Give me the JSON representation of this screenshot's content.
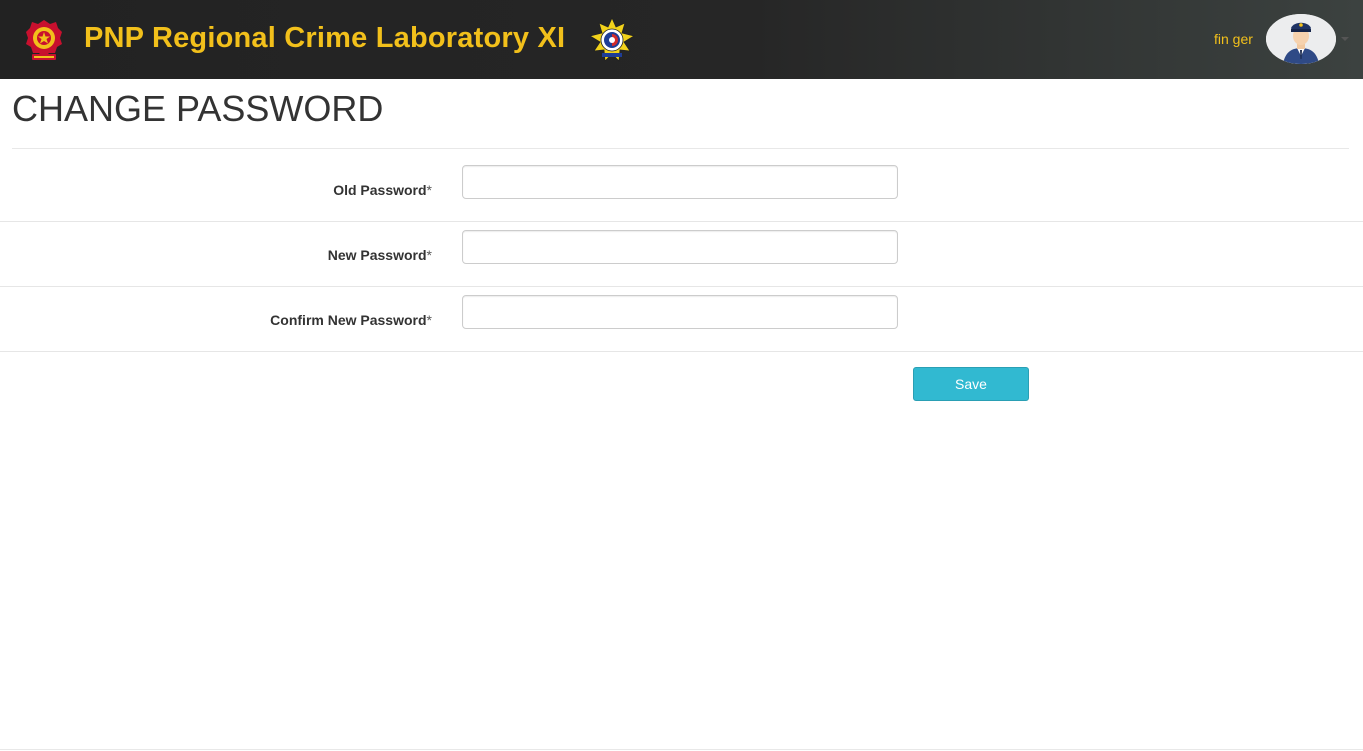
{
  "header": {
    "brand_title": "PNP Regional Crime Laboratory XI",
    "left_logo_icon": "pnp-seal-icon",
    "right_logo_icon": "crime-lab-badge-icon",
    "user_name": "fin ger",
    "avatar_icon": "police-officer-avatar-icon",
    "brand_color": "#f2c01b",
    "navbar_color": "#222222"
  },
  "page": {
    "title": "CHANGE PASSWORD"
  },
  "form": {
    "fields": [
      {
        "label": "Old Password",
        "required_marker": "*",
        "value": "",
        "placeholder": ""
      },
      {
        "label": "New Password",
        "required_marker": "*",
        "value": "",
        "placeholder": ""
      },
      {
        "label": "Confirm New Password",
        "required_marker": "*",
        "value": "",
        "placeholder": ""
      }
    ],
    "save_label": "Save",
    "save_color": "#31b9d1"
  }
}
